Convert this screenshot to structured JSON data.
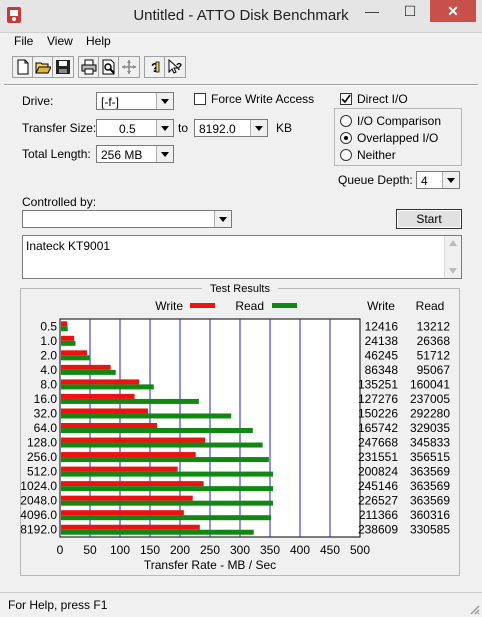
{
  "window": {
    "title": "Untitled - ATTO Disk Benchmark",
    "minimize": "—",
    "maximize": "☐",
    "close": "✕"
  },
  "menu": [
    {
      "label": "File"
    },
    {
      "label": "View"
    },
    {
      "label": "Help"
    }
  ],
  "toolbar": [
    "new-icon",
    "open-icon",
    "save-icon",
    "print-icon",
    "print-preview-icon",
    "move-icon",
    "help-icon",
    "context-help-icon"
  ],
  "drive": {
    "label": "Drive:",
    "value": "[-f-]"
  },
  "force_write": {
    "label": "Force Write Access",
    "checked": false
  },
  "direct_io": {
    "label": "Direct I/O",
    "checked": true
  },
  "transfer_size": {
    "label": "Transfer Size:",
    "from": "0.5",
    "to_label": "to",
    "to": "8192.0",
    "unit": "KB"
  },
  "io_mode": {
    "options": [
      "I/O Comparison",
      "Overlapped I/O",
      "Neither"
    ],
    "selected": "Overlapped I/O"
  },
  "total_length": {
    "label": "Total Length:",
    "value": "256 MB"
  },
  "queue_depth": {
    "label": "Queue Depth:",
    "value": "4"
  },
  "controlled_by": {
    "label": "Controlled by:",
    "value": ""
  },
  "start_button": "Start",
  "description": "Inateck KT9001",
  "results": {
    "title": "Test Results",
    "write_legend": "Write",
    "read_legend": "Read",
    "write_header": "Write",
    "read_header": "Read"
  },
  "status_text": "For Help, press F1",
  "colors": {
    "write": "#ee1111",
    "read": "#118811",
    "grid": "#2222cc"
  },
  "chart_data": {
    "type": "bar",
    "orientation": "horizontal",
    "title": "Test Results",
    "xlabel": "Transfer Rate - MB / Sec",
    "xlim": [
      0,
      500
    ],
    "xticks": [
      "0",
      "50",
      "100",
      "150",
      "200",
      "250",
      "300",
      "350",
      "400",
      "450",
      "500"
    ],
    "categories": [
      "0.5",
      "1.0",
      "2.0",
      "4.0",
      "8.0",
      "16.0",
      "32.0",
      "64.0",
      "128.0",
      "256.0",
      "512.0",
      "1024.0",
      "2048.0",
      "4096.0",
      "8192.0"
    ],
    "series": [
      {
        "name": "Write",
        "values": [
          12416,
          24138,
          46245,
          86348,
          135251,
          127276,
          150226,
          165742,
          247668,
          231551,
          200824,
          245146,
          226527,
          211366,
          238609
        ]
      },
      {
        "name": "Read",
        "values": [
          13212,
          26368,
          51712,
          95067,
          160041,
          237005,
          292280,
          329035,
          345833,
          356515,
          363569,
          363569,
          363569,
          360316,
          330585
        ]
      }
    ],
    "grid": true,
    "legend": "top"
  }
}
